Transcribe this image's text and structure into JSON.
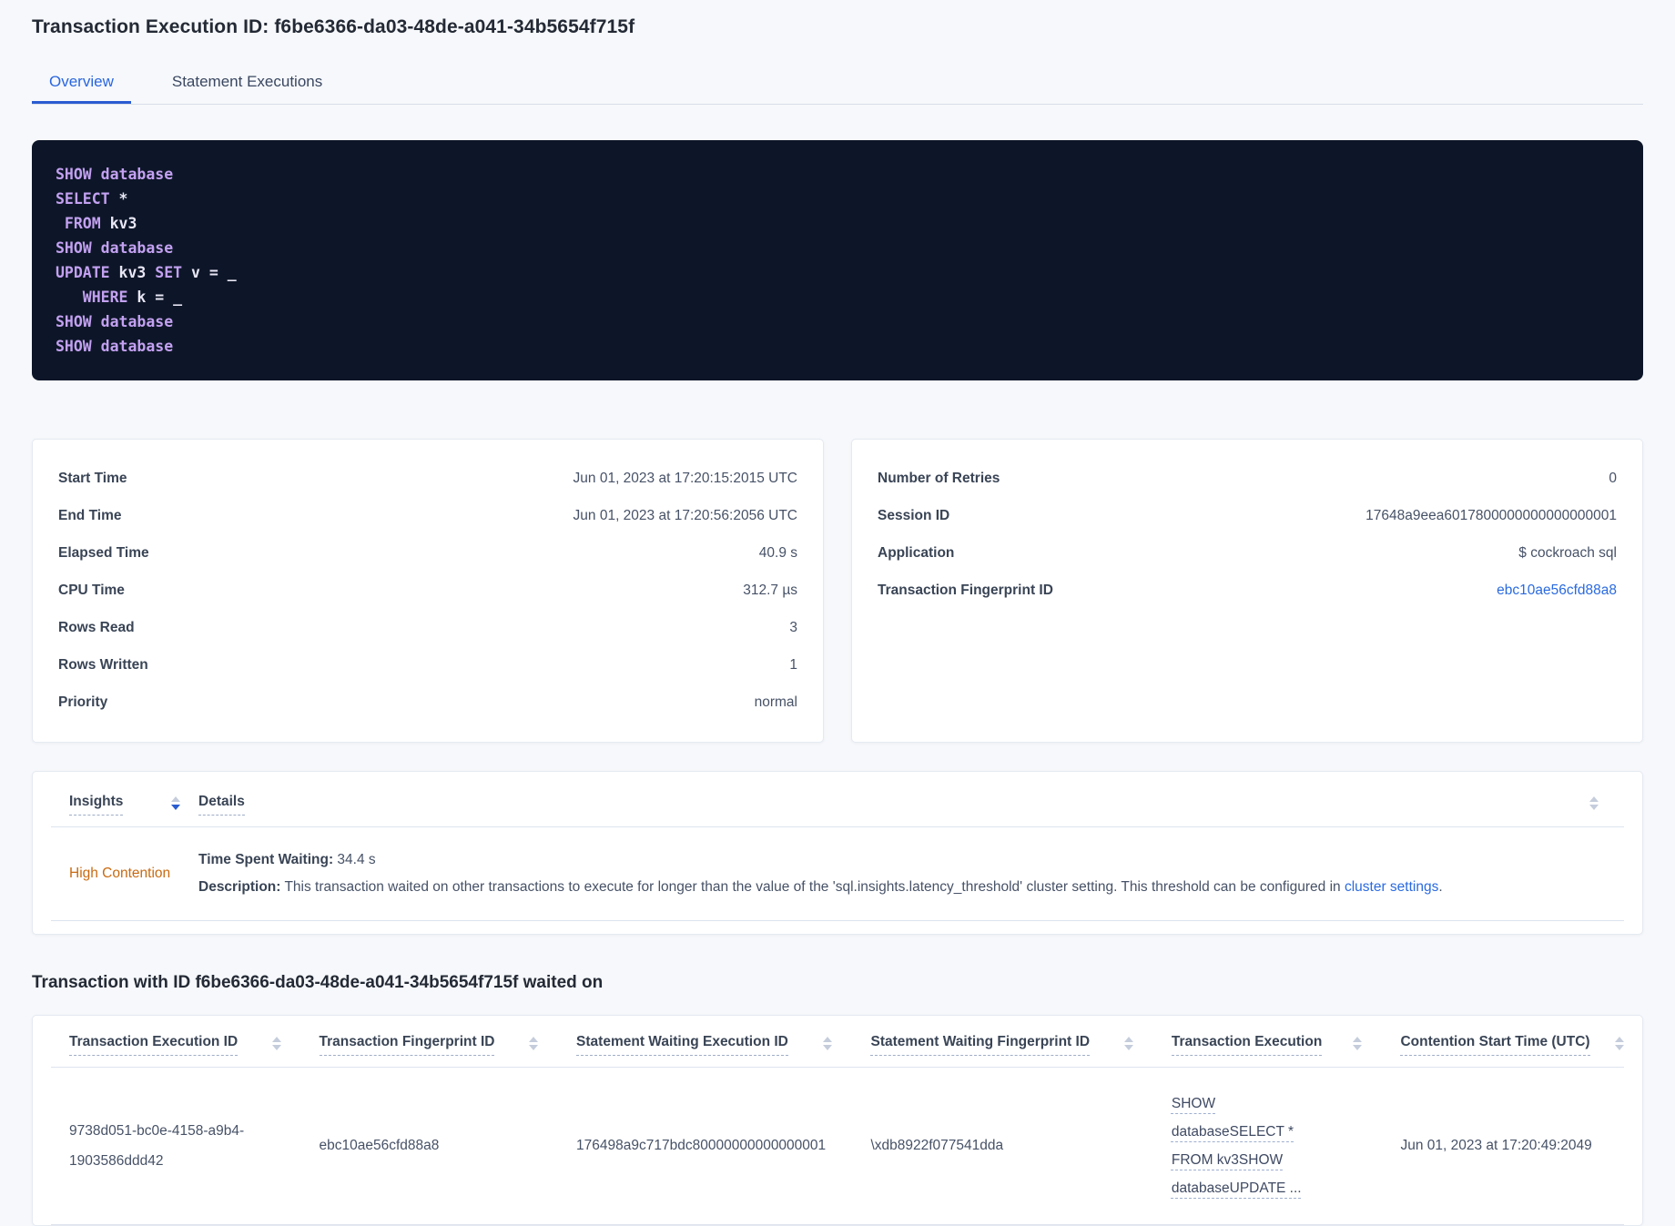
{
  "page": {
    "title": "Transaction Execution ID: f6be6366-da03-48de-a041-34b5654f715f",
    "tabs": [
      {
        "label": "Overview"
      },
      {
        "label": "Statement Executions"
      }
    ]
  },
  "sql": {
    "lines": [
      {
        "k1": "SHOW database"
      },
      {
        "k1": "SELECT ",
        "i1": "*"
      },
      {
        "k1": " FROM ",
        "i1": "kv3"
      },
      {
        "k1": "SHOW database"
      },
      {
        "k1": "UPDATE ",
        "i1": "kv3 ",
        "k2": "SET ",
        "i2": "v = _"
      },
      {
        "k1": "   WHERE ",
        "i1": "k = _"
      },
      {
        "k1": "SHOW database"
      },
      {
        "k1": "SHOW database"
      }
    ]
  },
  "summary_left": {
    "rows": [
      {
        "label": "Start Time",
        "value": "Jun 01, 2023 at 17:20:15:2015 UTC"
      },
      {
        "label": "End Time",
        "value": "Jun 01, 2023 at 17:20:56:2056 UTC"
      },
      {
        "label": "Elapsed Time",
        "value": "40.9 s"
      },
      {
        "label": "CPU Time",
        "value": "312.7 µs"
      },
      {
        "label": "Rows Read",
        "value": "3"
      },
      {
        "label": "Rows Written",
        "value": "1"
      },
      {
        "label": "Priority",
        "value": "normal"
      }
    ]
  },
  "summary_right": {
    "rows": [
      {
        "label": "Number of Retries",
        "value": "0"
      },
      {
        "label": "Session ID",
        "value": "17648a9eea6017800000000000000001"
      },
      {
        "label": "Application",
        "value": "$ cockroach sql"
      },
      {
        "label": "Transaction Fingerprint ID",
        "value": "ebc10ae56cfd88a8"
      }
    ]
  },
  "insights": {
    "columns": [
      {
        "label": "Insights"
      },
      {
        "label": "Details"
      }
    ],
    "row": {
      "insight": "High Contention",
      "waiting_label": "Time Spent Waiting:",
      "waiting_value": " 34.4 s",
      "description_label": "Description:",
      "description_text": " This transaction waited on other transactions to execute for longer than the value of the 'sql.insights.latency_threshold' cluster setting. This threshold can be configured in ",
      "description_link": "cluster settings",
      "description_suffix": "."
    }
  },
  "waited": {
    "heading": "Transaction with ID f6be6366-da03-48de-a041-34b5654f715f waited on",
    "columns": [
      {
        "label": "Transaction Execution ID"
      },
      {
        "label": "Transaction Fingerprint ID"
      },
      {
        "label": "Statement Waiting Execution ID"
      },
      {
        "label": "Statement Waiting Fingerprint ID"
      },
      {
        "label": "Transaction Execution"
      },
      {
        "label": "Contention Start Time (UTC)"
      }
    ],
    "row": {
      "transaction_execution_id": "9738d051-bc0e-4158-a9b4-1903586ddd42",
      "transaction_fingerprint_id": "ebc10ae56cfd88a8",
      "statement_waiting_execution_id": "176498a9c717bdc80000000000000001",
      "statement_waiting_fingerprint_id": "\\xdb8922f077541dda",
      "transaction_execution": "SHOW databaseSELECT * FROM kv3SHOW databaseUPDATE ...",
      "contention_start_time": "Jun 01, 2023 at 17:20:49:2049"
    }
  },
  "colors": {
    "accent_blue": "#2a66df",
    "tab_underline_blue": "#2a5cd1",
    "insight_orange": "#c96a10",
    "code_background": "#0d1628",
    "code_keyword": "#c3a1f1",
    "code_identifier": "#e9e7f6",
    "page_background": "#f6f8fb"
  }
}
